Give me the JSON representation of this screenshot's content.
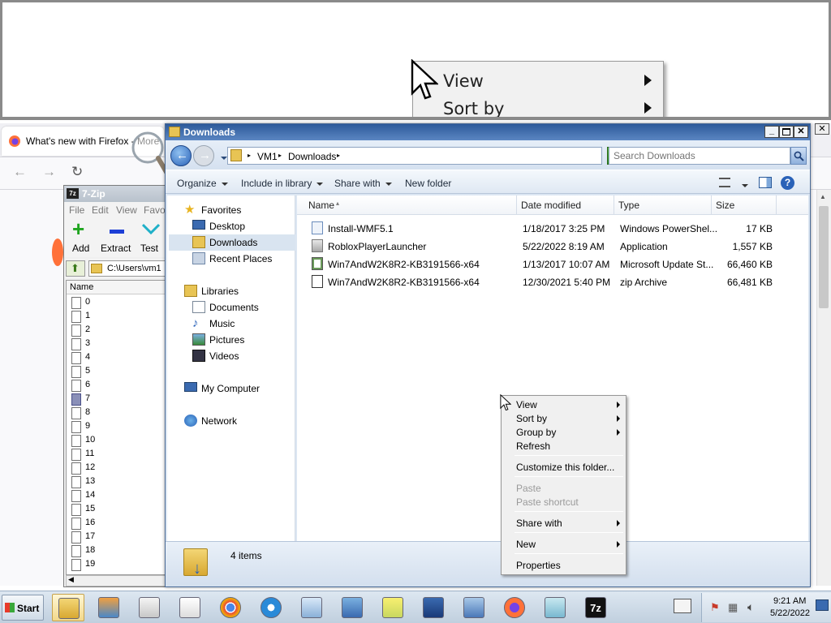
{
  "magnifier": {
    "menu_items": [
      {
        "label": "View"
      },
      {
        "label": "Sort by"
      }
    ]
  },
  "firefox": {
    "tab_title": "What's new with Firefox - More pr"
  },
  "sevenzip": {
    "title": "7-Zip",
    "menu": [
      "File",
      "Edit",
      "View",
      "Favo"
    ],
    "toolbar": [
      {
        "label": "Add",
        "icon": "plus-icon",
        "color": "#1fa51f"
      },
      {
        "label": "Extract",
        "icon": "minus-icon",
        "color": "#1d3fd6"
      },
      {
        "label": "Test",
        "icon": "check-icon",
        "color": "#1fb0c8"
      }
    ],
    "path": "C:\\Users\\vm1",
    "column": "Name",
    "items": [
      "0",
      "1",
      "2",
      "3",
      "4",
      "5",
      "6",
      "7",
      "8",
      "9",
      "10",
      "11",
      "12",
      "13",
      "14",
      "15",
      "16",
      "17",
      "18",
      "19"
    ],
    "selected_index": 7
  },
  "explorer": {
    "title": "Downloads",
    "breadcrumb": [
      "VM1",
      "Downloads"
    ],
    "search_placeholder": "Search Downloads",
    "commands": [
      "Organize",
      "Include in library",
      "Share with",
      "New folder"
    ],
    "nav": {
      "favorites": "Favorites",
      "favorites_items": [
        "Desktop",
        "Downloads",
        "Recent Places"
      ],
      "libraries": "Libraries",
      "libraries_items": [
        "Documents",
        "Music",
        "Pictures",
        "Videos"
      ],
      "computer": "My Computer",
      "network": "Network"
    },
    "columns": {
      "name": "Name",
      "date": "Date modified",
      "type": "Type",
      "size": "Size"
    },
    "files": [
      {
        "name": "Install-WMF5.1",
        "date": "1/18/2017 3:25 PM",
        "type": "Windows PowerShel...",
        "size": "17 KB",
        "icon": "powershell-script-icon"
      },
      {
        "name": "RobloxPlayerLauncher",
        "date": "5/22/2022 8:19 AM",
        "type": "Application",
        "size": "1,557 KB",
        "icon": "application-icon"
      },
      {
        "name": "Win7AndW2K8R2-KB3191566-x64",
        "date": "1/13/2017 10:07 AM",
        "type": "Microsoft Update St...",
        "size": "66,460 KB",
        "icon": "update-package-icon"
      },
      {
        "name": "Win7AndW2K8R2-KB3191566-x64",
        "date": "12/30/2021 5:40 PM",
        "type": "zip Archive",
        "size": "66,481 KB",
        "icon": "zip-archive-icon"
      }
    ],
    "item_count": "4 items"
  },
  "context_menu": {
    "view": "View",
    "sort_by": "Sort by",
    "group_by": "Group by",
    "refresh": "Refresh",
    "customize": "Customize this folder...",
    "paste": "Paste",
    "paste_shortcut": "Paste shortcut",
    "share_with": "Share with",
    "new": "New",
    "properties": "Properties"
  },
  "taskbar": {
    "start": "Start",
    "time": "9:21 AM",
    "date": "5/22/2022",
    "apps": [
      "explorer-icon",
      "media-player-icon",
      "paint-icon",
      "solitaire-icon",
      "chrome-icon",
      "internet-explorer-icon",
      "notepad-icon",
      "control-panel-icon",
      "sticky-notes-icon",
      "powershell-icon",
      "remote-desktop-icon",
      "firefox-icon",
      "snipping-tool-icon",
      "seven-zip-icon"
    ]
  },
  "colors": {
    "explorer_title": "#2d5a9a",
    "selection": "#cde3f7",
    "context_bg": "#f0f0f0"
  }
}
